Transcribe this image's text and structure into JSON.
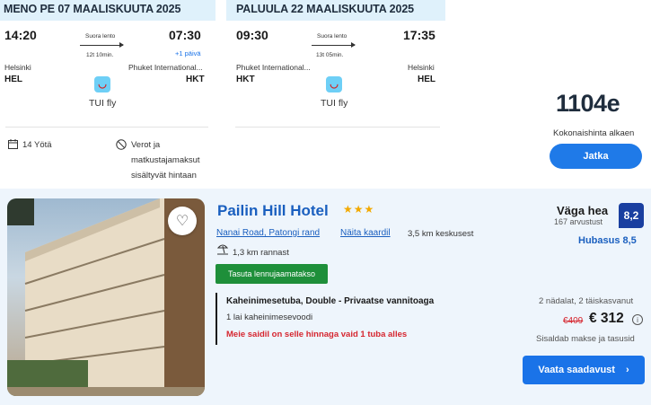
{
  "outbound": {
    "header": "MENO PE 07 MAALISKUUTA 2025",
    "depart_time": "14:20",
    "arrive_time": "07:30",
    "direct_label": "Suora lento",
    "duration": "12t 10min.",
    "plus_day": "+1 päivä",
    "from_city": "Helsinki",
    "to_city": "Phuket International...",
    "from_code": "HEL",
    "to_code": "HKT",
    "airline": "TUI fly",
    "airline_logo_icon": "tui-smile-icon"
  },
  "inbound": {
    "header": "PALUULA 22 MAALISKUUTA 2025",
    "depart_time": "09:30",
    "arrive_time": "17:35",
    "direct_label": "Suora lento",
    "duration": "13t 05min.",
    "from_city": "Phuket International...",
    "to_city": "Helsinki",
    "from_code": "HKT",
    "to_code": "HEL",
    "airline": "TUI fly",
    "airline_logo_icon": "tui-smile-icon"
  },
  "trip_meta": {
    "nights_icon": "calendar-icon",
    "nights": "14 Yötä",
    "fees_icon": "no-fees-icon",
    "fees_lines": [
      "Verot ja",
      "matkustajamaksut",
      "sisältyvät hintaan"
    ]
  },
  "summary": {
    "total_price": "1104e",
    "total_label": "Kokonaishinta alkaen",
    "next_button": "Jatka"
  },
  "hotel": {
    "name": "Pailin Hill Hotel",
    "stars": 3,
    "stars_text": "★★★",
    "address_link": "Nanai Road, Patongi rand",
    "map_link": "Näita kaardil",
    "distance_center": "3,5 km keskusest",
    "beach_icon": "beach-umbrella-icon",
    "distance_beach": "1,3 km rannast",
    "promo_badge": "Tasuta lennujaamatakso",
    "room_type": "Kaheinimesetuba, Double - Privaatse vannitoaga",
    "bed_info": "1 lai kaheinimesevoodi",
    "scarcity": "Meie saidil on selle hinnaga vaid 1 tuba alles",
    "rating_word": "Väga hea",
    "review_count": "167 arvustust",
    "score": "8,2",
    "cleanliness": "Hubasus 8,5",
    "stay_info": "2 nädalat, 2 täiskasvanut",
    "old_price": "€409",
    "new_price": "€ 312",
    "taxes_included": "Sisaldab makse ja tasusid",
    "availability_button": "Vaata saadavust",
    "availability_arrow": "›",
    "favorite_icon": "heart-icon"
  },
  "colors": {
    "header_band": "#dff1fb",
    "accent_blue": "#1a73e8",
    "link_blue": "#1a5fbf",
    "promo_green": "#1e8f3a",
    "scarcity_red": "#d6262f",
    "score_navy": "#1a3fa0",
    "star_gold": "#f2a900"
  }
}
